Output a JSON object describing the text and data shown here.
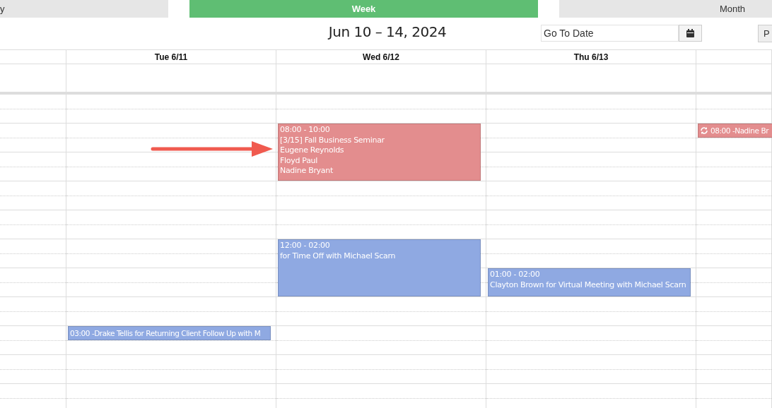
{
  "view_tabs": [
    {
      "label": "y",
      "selected": false
    },
    {
      "label": "Week",
      "selected": true
    },
    {
      "label": "Month",
      "selected": false
    }
  ],
  "date_range": "Jun 10 – 14, 2024",
  "go_to_date": {
    "placeholder": "Go To Date"
  },
  "side_button": "P",
  "days": [
    {
      "label": "Tue 6/11",
      "events": [
        {
          "kind": "compact",
          "color": "#8fa9e2",
          "text": "03:00 -Drake Tellis for Returning Client Follow Up with M"
        }
      ]
    },
    {
      "label": "Wed 6/12",
      "events": [
        {
          "kind": "block",
          "color": "#e38d8e",
          "time": "08:00 - 10:00",
          "lines": [
            "[3/15] Fall Business Seminar",
            "Eugene Reynolds",
            "Floyd Paul",
            "Nadine Bryant"
          ]
        },
        {
          "kind": "block",
          "color": "#8fa9e2",
          "time": "12:00 - 02:00",
          "lines": [
            "for Time Off with Michael Scarn"
          ]
        }
      ]
    },
    {
      "label": "Thu 6/13",
      "events": [
        {
          "kind": "block",
          "color": "#8fa9e2",
          "time": "01:00 - 02:00",
          "lines": [
            "Clayton Brown for Virtual Meeting with Michael Scarn"
          ]
        }
      ]
    },
    {
      "events": [
        {
          "kind": "compact",
          "color": "#e38d8e",
          "text": "08:00 -Nadine Br",
          "recurring": true
        }
      ]
    }
  ]
}
